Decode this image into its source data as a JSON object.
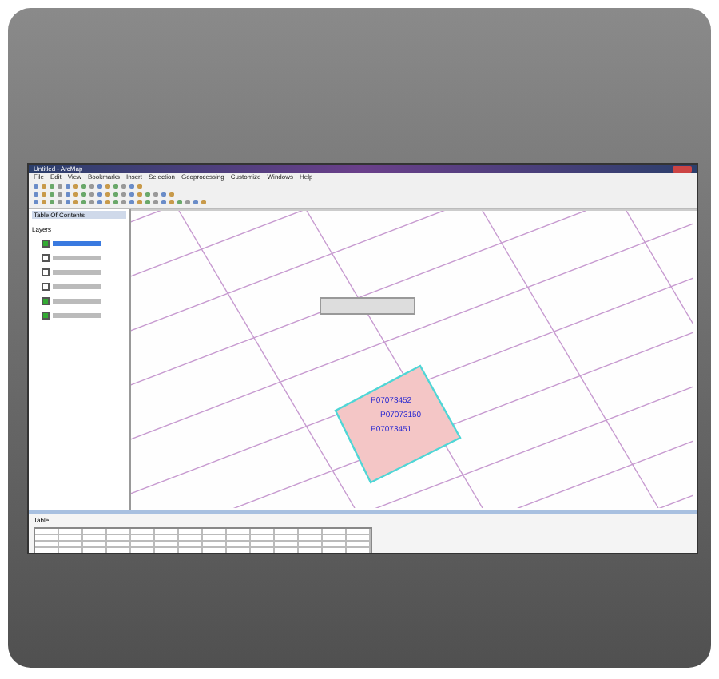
{
  "window": {
    "title": "Untitled - ArcMap"
  },
  "menu": [
    "File",
    "Edit",
    "View",
    "Bookmarks",
    "Insert",
    "Selection",
    "Geoprocessing",
    "Customize",
    "Windows",
    "Help"
  ],
  "toc": {
    "title": "Table Of Contents",
    "root": "Layers",
    "layers": [
      {
        "checked": true,
        "selected": true
      },
      {
        "checked": false,
        "selected": false
      },
      {
        "checked": false,
        "selected": false
      },
      {
        "checked": false,
        "selected": false
      },
      {
        "checked": true,
        "selected": false
      },
      {
        "checked": true,
        "selected": false
      }
    ]
  },
  "map": {
    "parcel_labels": [
      "P07073452",
      "P07073150",
      "P07073451"
    ]
  },
  "table_window": {
    "title": "Table"
  }
}
